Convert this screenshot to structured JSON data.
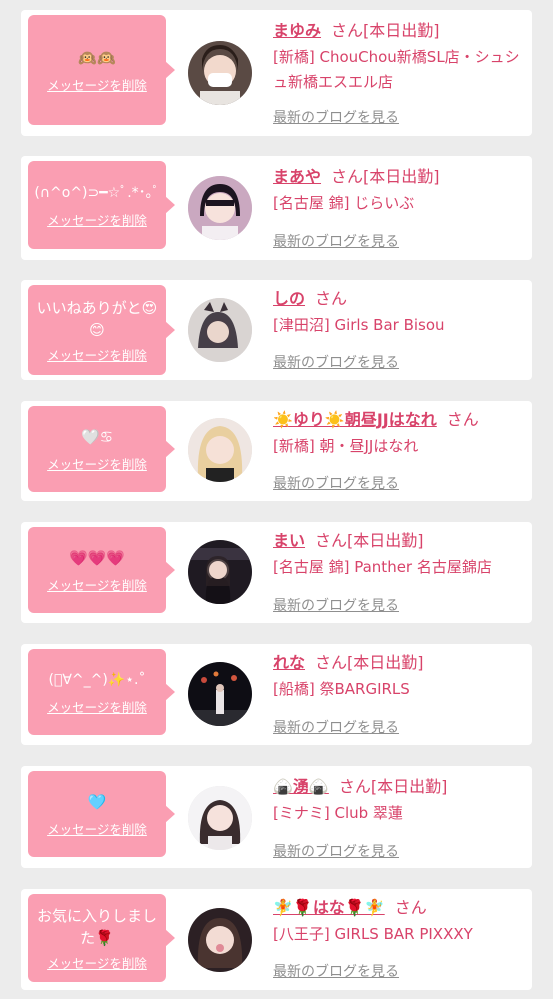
{
  "common": {
    "delete_label": "メッセージを削除",
    "san": "さん",
    "blog_label": "最新のブログを見る"
  },
  "items": [
    {
      "message": "🙉🙉",
      "name": "まゆみ",
      "status": "[本日出勤]",
      "shop": "[新橋] ChouChou新橋SL店・シュシュ新橋エスエル店",
      "avatar_icon": "girl-face-mask-photo"
    },
    {
      "message": "(∩^o^)⊃━☆ﾟ.*･｡ﾟ",
      "name": "まあや",
      "status": "[本日出勤]",
      "shop": "[名古屋 錦] じらいぶ",
      "avatar_icon": "girl-photo"
    },
    {
      "message": "いいねありがと😍😊",
      "name": "しの",
      "status": "",
      "shop": "[津田沼] Girls Bar Bisou",
      "avatar_icon": "girl-photo"
    },
    {
      "message": "🤍♋",
      "name": "☀️ゆり☀️朝昼JJはなれ",
      "status": "",
      "shop": "[新橋] 朝・昼JJはなれ",
      "avatar_icon": "girl-photo"
    },
    {
      "message": "💗💗💗",
      "name": "まい",
      "status": "[本日出勤]",
      "shop": "[名古屋 錦] Panther 名古屋錦店",
      "avatar_icon": "girl-photo"
    },
    {
      "message": "(ﾟ∀^_^)✨⋆.˚",
      "name": "れな",
      "status": "[本日出勤]",
      "shop": "[船橋] 祭BARGIRLS",
      "avatar_icon": "girl-night-photo"
    },
    {
      "message": "🩵",
      "name": "🍙湧🍙",
      "status": "[本日出勤]",
      "shop": "[ミナミ] Club 翠蓮",
      "avatar_icon": "girl-photo"
    },
    {
      "message": "お気に入りしました🌹",
      "name": "🧚🌹はな🌹🧚",
      "status": "",
      "shop": "[八王子] GIRLS BAR PIXXXY",
      "avatar_icon": "girl-photo"
    }
  ],
  "colors": {
    "background": "#ececec",
    "card": "#ffffff",
    "bubble": "#fa9eb2",
    "accent_pink": "#d8436a",
    "blog_link_gray": "#8f8f8f"
  }
}
